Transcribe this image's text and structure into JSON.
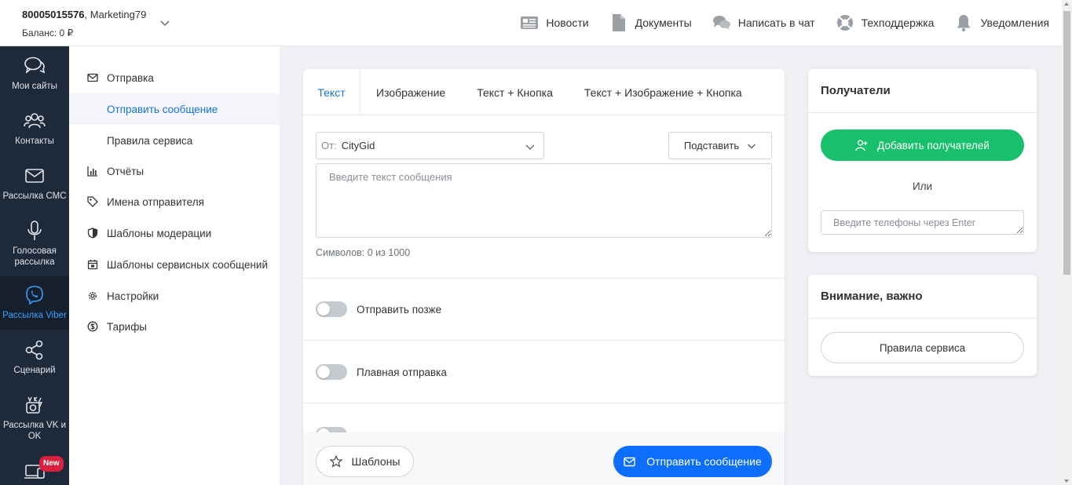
{
  "header": {
    "account_id": "80005015576",
    "account_name": ", Marketing79",
    "balance": "Баланс: 0 ₽",
    "nav": [
      {
        "label": "Новости",
        "icon": "news-icon"
      },
      {
        "label": "Документы",
        "icon": "document-icon"
      },
      {
        "label": "Написать в чат",
        "icon": "chat-icon"
      },
      {
        "label": "Техподдержка",
        "icon": "lifebuoy-icon"
      },
      {
        "label": "Уведомления",
        "icon": "bell-icon"
      }
    ]
  },
  "darkbar": {
    "items": [
      {
        "label": "Мои сайты",
        "icon": "chat-bubbles-icon"
      },
      {
        "label": "Контакты",
        "icon": "contacts-icon"
      },
      {
        "label": "Рассылка СМС",
        "icon": "envelope-icon"
      },
      {
        "label": "Голосовая рассылка",
        "icon": "microphone-icon"
      },
      {
        "label": "Рассылка Viber",
        "icon": "viber-icon",
        "active": true
      },
      {
        "label": "Сценарий",
        "icon": "share-nodes-icon"
      },
      {
        "label": "Рассылка VK и OK",
        "icon": "vk-ok-icon"
      },
      {
        "label": "",
        "icon": "devices-icon",
        "badge": "New"
      }
    ]
  },
  "submenu": {
    "items": [
      {
        "label": "Отправка",
        "icon": "envelope-icon"
      },
      {
        "label": "Отправить сообщение",
        "child": true,
        "active": true
      },
      {
        "label": "Правила сервиса",
        "child": true
      },
      {
        "label": "Отчёты",
        "icon": "bar-chart-icon"
      },
      {
        "label": "Имена отправителя",
        "icon": "tag-icon"
      },
      {
        "label": "Шаблоны модерации",
        "icon": "shield-icon"
      },
      {
        "label": "Шаблоны сервисных сообщений",
        "icon": "calendar-icon"
      },
      {
        "label": "Настройки",
        "icon": "gear-icon"
      },
      {
        "label": "Тарифы",
        "icon": "dollar-circle-icon"
      }
    ]
  },
  "composer": {
    "tabs": [
      "Текст",
      "Изображение",
      "Текст + Кнопка",
      "Текст + Изображение + Кнопка"
    ],
    "active_tab": 0,
    "from_label": "От:",
    "from_value": "CityGid",
    "insert_label": "Подставить",
    "message_placeholder": "Введите текст сообщения",
    "symbols": "Символов: 0 из 1000",
    "toggles": [
      {
        "label": "Отправить позже",
        "on": false
      },
      {
        "label": "Плавная отправка",
        "on": false
      }
    ],
    "templates_label": "Шаблоны",
    "send_label": "Отправить сообщение"
  },
  "recipients": {
    "title": "Получатели",
    "add_label": "Добавить получателей",
    "or_label": "Или",
    "phones_placeholder": "Введите телефоны через Enter"
  },
  "important": {
    "title": "Внимание, важно",
    "rules_label": "Правила сервиса"
  },
  "colors": {
    "sidebar_bg": "#1e2a3a",
    "accent_blue": "#0d6efd",
    "link_blue": "#1a73d9",
    "green": "#19c06b",
    "badge_red": "#d9213f"
  }
}
